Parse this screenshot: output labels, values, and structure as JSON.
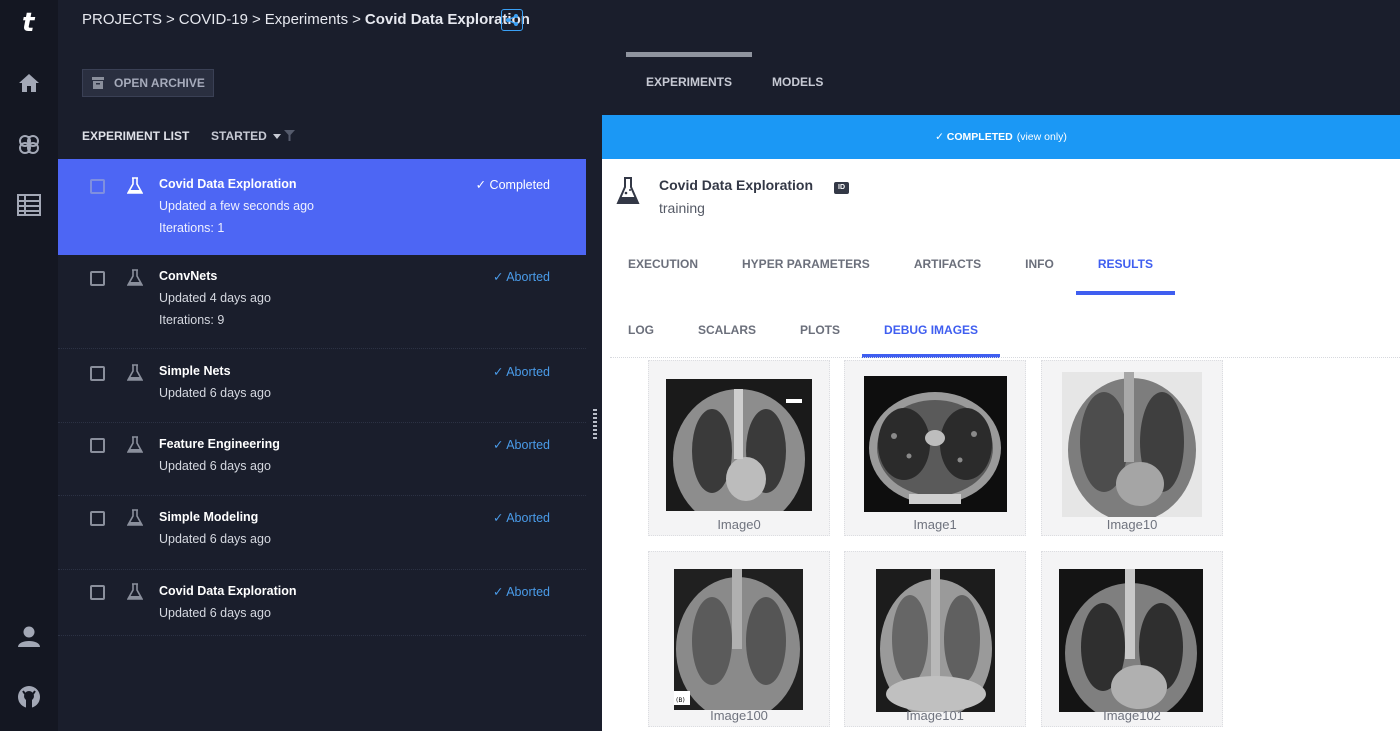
{
  "breadcrumb": {
    "projects": "PROJECTS",
    "project": "COVID-19",
    "section": "Experiments",
    "current": "Covid Data Exploration",
    "separator": ">"
  },
  "toolbar": {
    "open_archive": "OPEN ARCHIVE"
  },
  "top_tabs": [
    {
      "label": "EXPERIMENTS",
      "active": true
    },
    {
      "label": "MODELS",
      "active": false
    }
  ],
  "list_header": {
    "title": "EXPERIMENT LIST",
    "sort": "STARTED",
    "sort_icon": "caret-down-icon"
  },
  "experiments": [
    {
      "name": "Covid Data Exploration",
      "status": "Completed",
      "updated": "Updated a few seconds ago",
      "iterations": "Iterations: 1",
      "selected": true
    },
    {
      "name": "ConvNets",
      "status": "Aborted",
      "updated": "Updated 4 days ago",
      "iterations": "Iterations: 9",
      "selected": false
    },
    {
      "name": "Simple Nets",
      "status": "Aborted",
      "updated": "Updated 6 days ago",
      "iterations": "",
      "selected": false
    },
    {
      "name": "Feature Engineering",
      "status": "Aborted",
      "updated": "Updated 6 days ago",
      "iterations": "",
      "selected": false
    },
    {
      "name": "Simple Modeling",
      "status": "Aborted",
      "updated": "Updated 6 days ago",
      "iterations": "",
      "selected": false
    },
    {
      "name": "Covid Data Exploration",
      "status": "Aborted",
      "updated": "Updated 6 days ago",
      "iterations": "",
      "selected": false
    }
  ],
  "banner": {
    "status": "COMPLETED",
    "mode": "(view only)",
    "icon": "check-icon"
  },
  "detail": {
    "name": "Covid Data Exploration",
    "type": "training",
    "id_badge": "ID"
  },
  "detail_tabs": [
    {
      "label": "EXECUTION",
      "active": false
    },
    {
      "label": "HYPER PARAMETERS",
      "active": false
    },
    {
      "label": "ARTIFACTS",
      "active": false
    },
    {
      "label": "INFO",
      "active": false
    },
    {
      "label": "RESULTS",
      "active": true
    }
  ],
  "result_tabs": [
    {
      "label": "LOG",
      "active": false
    },
    {
      "label": "SCALARS",
      "active": false
    },
    {
      "label": "PLOTS",
      "active": false
    },
    {
      "label": "DEBUG IMAGES",
      "active": true
    }
  ],
  "debug_images": [
    {
      "caption": "Image0",
      "kind": "chest x-ray"
    },
    {
      "caption": "Image1",
      "kind": "chest CT scan"
    },
    {
      "caption": "Image10",
      "kind": "chest x-ray"
    },
    {
      "caption": "Image100",
      "kind": "chest x-ray"
    },
    {
      "caption": "Image101",
      "kind": "chest x-ray"
    },
    {
      "caption": "Image102",
      "kind": "chest x-ray"
    }
  ],
  "image_marks": {
    "image100_tag": "(B)"
  },
  "colors": {
    "sidebar_bg": "#141722",
    "panel_bg": "#1a1e2c",
    "selected_row": "#4d66f4",
    "banner": "#1b98f5",
    "accent": "#3f5ef0",
    "status_link": "#4a9be8"
  }
}
